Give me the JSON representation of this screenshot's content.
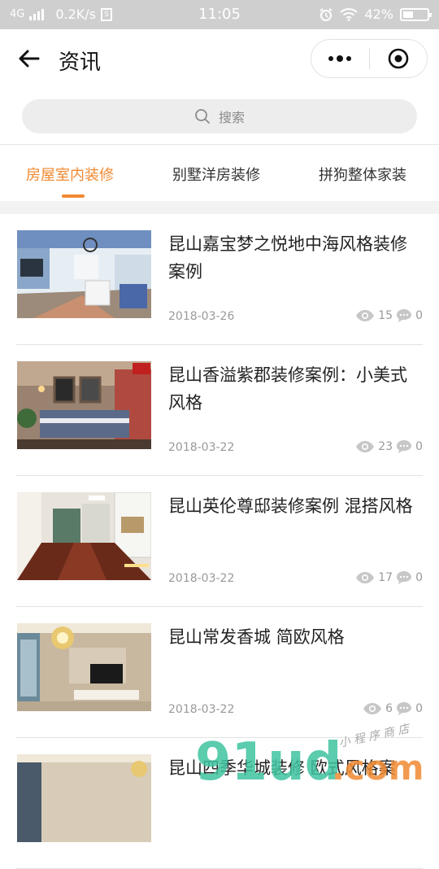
{
  "status_bar": {
    "network": "4G",
    "speed": "0.2K/s",
    "sim_icon": "S",
    "time": "11:05",
    "battery": "42%",
    "battery_level": 0.42
  },
  "nav": {
    "title": "资讯"
  },
  "search": {
    "placeholder": "搜索"
  },
  "tabs": [
    {
      "label": "房屋室内装修",
      "active": true
    },
    {
      "label": "别墅洋房装修",
      "active": false
    },
    {
      "label": "拼狗整体家装",
      "active": false
    }
  ],
  "articles": [
    {
      "title": "昆山嘉宝梦之悦地中海风格装修案例",
      "date": "2018-03-26",
      "views": "15",
      "comments": "0"
    },
    {
      "title": "昆山香溢紫郡装修案例：小美式风格",
      "date": "2018-03-22",
      "views": "23",
      "comments": "0"
    },
    {
      "title": "昆山英伦尊邸装修案例 混搭风格",
      "date": "2018-03-22",
      "views": "17",
      "comments": "0"
    },
    {
      "title": "昆山常发香城 简欧风格",
      "date": "2018-03-22",
      "views": "6",
      "comments": "0"
    },
    {
      "title": "昆山四季华城装修 欧式风格案",
      "date": "",
      "views": "",
      "comments": ""
    }
  ],
  "watermark": {
    "brand": "91ud.com",
    "tagline": "小程序商店"
  },
  "colors": {
    "accent": "#f08a32",
    "status_bar_bg": "#cfcfcf"
  }
}
